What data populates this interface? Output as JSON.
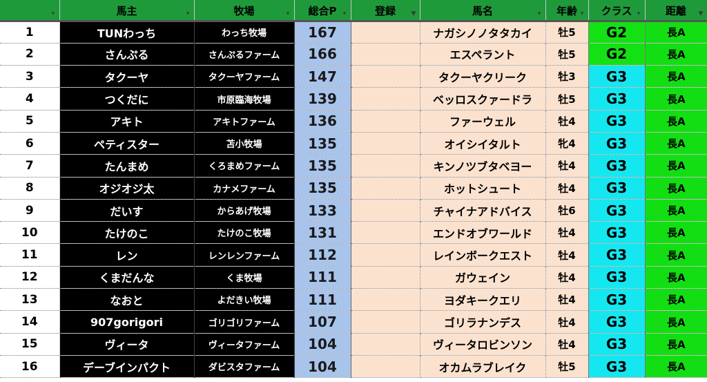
{
  "headers": {
    "owner": "馬主",
    "farm": "牧場",
    "points": "総合P",
    "registered": "登録",
    "horse": "馬名",
    "age": "年齢",
    "class": "クラス",
    "distance": "距離"
  },
  "colors": {
    "header_bg": "#1f9a3b",
    "owner_bg": "#000000",
    "points_bg": "#a9c4eb",
    "horse_bg": "#fbe2cf",
    "class_g2": "#14e114",
    "class_g3": "#15e7f0",
    "distance_bg": "#13de13"
  },
  "icons": {
    "filter_dropdown": "filter-dropdown-icon",
    "filter_active": "filter-active-icon"
  },
  "rows": [
    {
      "idx": "1",
      "owner": "TUNわっち",
      "farm": "わっち牧場",
      "points": "167",
      "registered": "",
      "horse": "ナガシノノタタカイ",
      "age": "牡5",
      "class": "G2",
      "distance": "長A"
    },
    {
      "idx": "2",
      "owner": "さんぷる",
      "farm": "さんぷるファーム",
      "points": "166",
      "registered": "",
      "horse": "エスペラント",
      "age": "牡5",
      "class": "G2",
      "distance": "長A"
    },
    {
      "idx": "3",
      "owner": "タクーヤ",
      "farm": "タクーヤファーム",
      "points": "147",
      "registered": "",
      "horse": "タクーヤクリーク",
      "age": "牡3",
      "class": "G3",
      "distance": "長A"
    },
    {
      "idx": "4",
      "owner": "つくだに",
      "farm": "市原臨海牧場",
      "points": "139",
      "registered": "",
      "horse": "ベッロスクァードラ",
      "age": "牡5",
      "class": "G3",
      "distance": "長A"
    },
    {
      "idx": "5",
      "owner": "アキト",
      "farm": "アキトファーム",
      "points": "136",
      "registered": "",
      "horse": "ファーウェル",
      "age": "牡4",
      "class": "G3",
      "distance": "長A"
    },
    {
      "idx": "6",
      "owner": "ペティスター",
      "farm": "苫小牧場",
      "points": "135",
      "registered": "",
      "horse": "オイシイタルト",
      "age": "牝4",
      "class": "G3",
      "distance": "長A"
    },
    {
      "idx": "7",
      "owner": "たんまめ",
      "farm": "くろまめファーム",
      "points": "135",
      "registered": "",
      "horse": "キンノツブタベヨー",
      "age": "牡4",
      "class": "G3",
      "distance": "長A"
    },
    {
      "idx": "8",
      "owner": "オジオジ太",
      "farm": "カナメファーム",
      "points": "135",
      "registered": "",
      "horse": "ホットシュート",
      "age": "牡4",
      "class": "G3",
      "distance": "長A"
    },
    {
      "idx": "9",
      "owner": "だいす",
      "farm": "からあげ牧場",
      "points": "133",
      "registered": "",
      "horse": "チャイナアドバイス",
      "age": "牡6",
      "class": "G3",
      "distance": "長A"
    },
    {
      "idx": "10",
      "owner": "たけのこ",
      "farm": "たけのこ牧場",
      "points": "131",
      "registered": "",
      "horse": "エンドオブワールド",
      "age": "牡4",
      "class": "G3",
      "distance": "長A"
    },
    {
      "idx": "11",
      "owner": "レン",
      "farm": "レンレンファーム",
      "points": "112",
      "registered": "",
      "horse": "レインボークエスト",
      "age": "牡4",
      "class": "G3",
      "distance": "長A"
    },
    {
      "idx": "12",
      "owner": "くまだんな",
      "farm": "くま牧場",
      "points": "111",
      "registered": "",
      "horse": "ガウェイン",
      "age": "牡4",
      "class": "G3",
      "distance": "長A"
    },
    {
      "idx": "13",
      "owner": "なおと",
      "farm": "よだきい牧場",
      "points": "111",
      "registered": "",
      "horse": "ヨダキークエリ",
      "age": "牡4",
      "class": "G3",
      "distance": "長A"
    },
    {
      "idx": "14",
      "owner": "907gorigori",
      "farm": "ゴリゴリファーム",
      "points": "107",
      "registered": "",
      "horse": "ゴリラナンデス",
      "age": "牡4",
      "class": "G3",
      "distance": "長A"
    },
    {
      "idx": "15",
      "owner": "ヴィータ",
      "farm": "ヴィータファーム",
      "points": "104",
      "registered": "",
      "horse": "ヴィータロビンソン",
      "age": "牡4",
      "class": "G3",
      "distance": "長A"
    },
    {
      "idx": "16",
      "owner": "デーブインパクト",
      "farm": "ダビスタファーム",
      "points": "104",
      "registered": "",
      "horse": "オカムラブレイク",
      "age": "牡5",
      "class": "G3",
      "distance": "長A"
    }
  ]
}
